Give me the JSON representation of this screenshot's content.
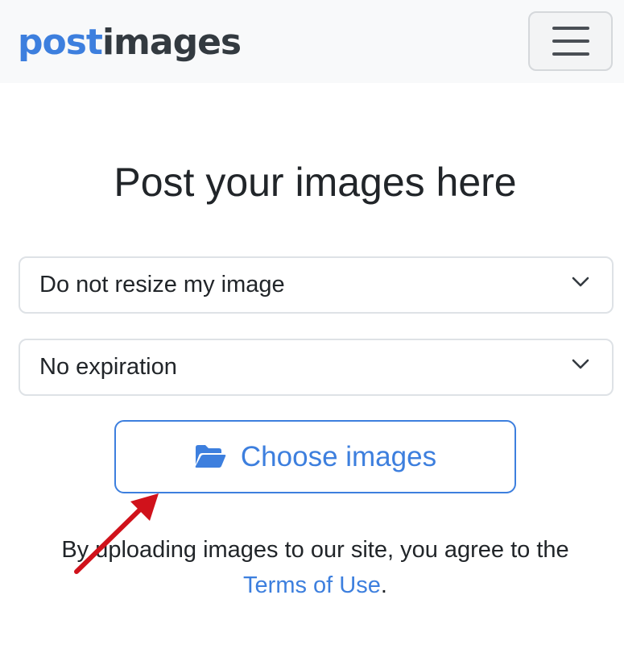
{
  "navbar": {
    "logo_part_a": "post",
    "logo_part_b": "images",
    "menu_icon": "hamburger-icon"
  },
  "main": {
    "title": "Post your images here",
    "resize_select": {
      "selected": "Do not resize my image",
      "icon": "chevron-down-icon"
    },
    "expiration_select": {
      "selected": "No expiration",
      "icon": "chevron-down-icon"
    },
    "choose_button": {
      "label": "Choose images",
      "icon": "folder-open-icon"
    },
    "terms": {
      "text": "By uploading images to our site, you agree to the",
      "link": "Terms of Use",
      "suffix": "."
    },
    "annotation_icon": "red-arrow-icon"
  },
  "colors": {
    "brand_blue": "#3d7fde",
    "brand_dark": "#333a40",
    "annotation_red": "#d0121b",
    "navbar_bg": "#f8f9fa"
  }
}
